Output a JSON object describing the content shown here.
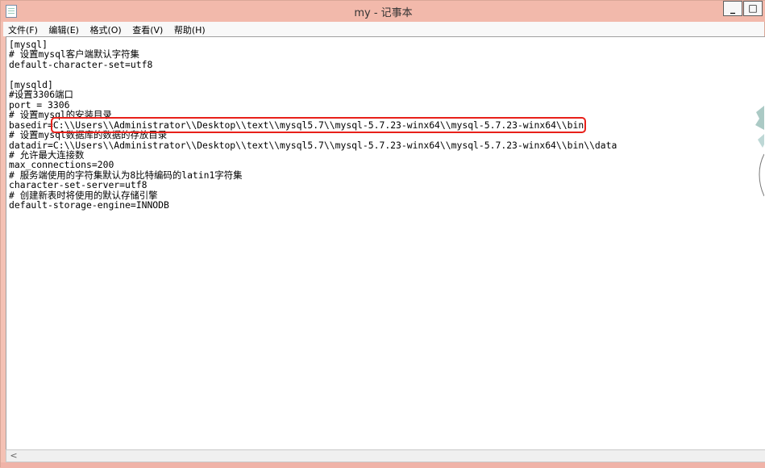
{
  "window": {
    "title": "my - 记事本",
    "minimize_glyph": "_",
    "maximize_glyph": "□"
  },
  "menu": {
    "items": [
      {
        "label": "文件(F)"
      },
      {
        "label": "编辑(E)"
      },
      {
        "label": "格式(O)"
      },
      {
        "label": "查看(V)"
      },
      {
        "label": "帮助(H)"
      }
    ]
  },
  "editor": {
    "line_01": "[mysql]",
    "line_02": "# 设置mysql客户端默认字符集",
    "line_03": "default-character-set=utf8",
    "line_04": "",
    "line_05": "[mysqld]",
    "line_06": "#设置3306端口",
    "line_07": "port = 3306",
    "line_08": "# 设置mysql的安装目录",
    "line_09_prefix": "basedir=",
    "line_09_path": "C:\\\\Users\\\\Administrator\\\\Desktop\\\\text\\\\mysql5.7\\\\mysql-5.7.23-winx64\\\\mysql-5.7.23-winx64\\\\bin",
    "line_10": "# 设置mysql数据库的数据的存放目录",
    "line_11": "datadir=C:\\\\Users\\\\Administrator\\\\Desktop\\\\text\\\\mysql5.7\\\\mysql-5.7.23-winx64\\\\mysql-5.7.23-winx64\\\\bin\\\\data",
    "line_12": "# 允许最大连接数",
    "line_13": "max_connections=200",
    "line_14": "# 服务端使用的字符集默认为8比特编码的latin1字符集",
    "line_15": "character-set-server=utf8",
    "line_16": "# 创建新表时将使用的默认存储引擎",
    "line_17": "default-storage-engine=INNODB"
  },
  "scrollbar": {
    "left_arrow_glyph": "<"
  },
  "colors": {
    "frame": "#f2b9ab",
    "highlight_border": "#e8201a"
  },
  "icons": {
    "app": "notepad-icon",
    "scroll": "scroll-left-arrow-icon"
  }
}
